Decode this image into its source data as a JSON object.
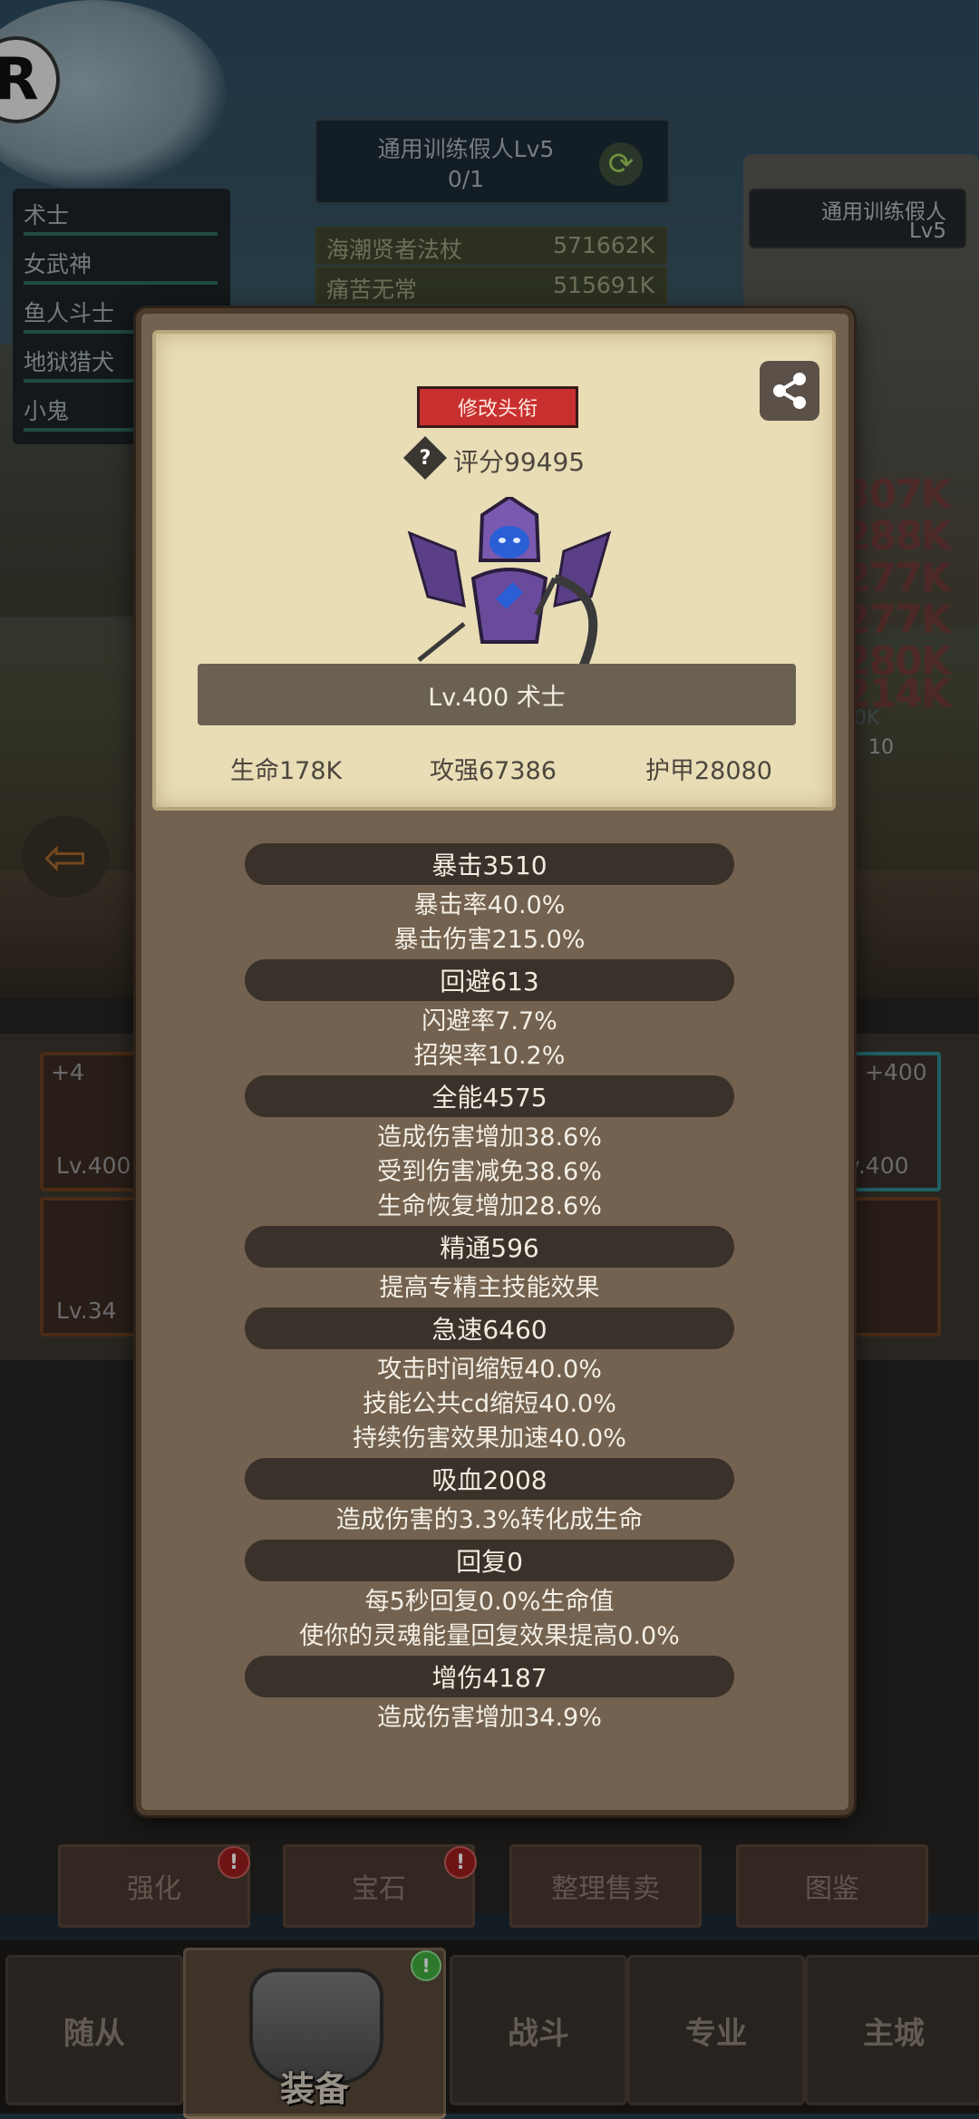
{
  "background": {
    "logo_letter": "R",
    "quest": {
      "title": "通用训练假人Lv5",
      "progress": "0/1",
      "refresh_icon": "refresh-icon"
    },
    "boss_label": {
      "name": "通用训练假人",
      "level": "Lv5"
    },
    "ranking": [
      {
        "name": "海潮贤者法杖",
        "value": "571662K"
      },
      {
        "name": "痛苦无常",
        "value": "515691K"
      }
    ],
    "team": [
      "术士",
      "女武神",
      "鱼人斗士",
      "地狱猎犬",
      "小鬼"
    ],
    "damage_numbers": [
      "307K",
      "288K",
      "277K",
      "277K",
      "280K",
      "214K"
    ],
    "side_values": [
      "90K",
      "10"
    ],
    "equipment_slots": [
      {
        "plus": "+4",
        "level": "Lv.400"
      },
      {
        "plus": "",
        "level": "Lv.34"
      },
      {
        "plus": "+400",
        "level": "v.400"
      },
      {
        "plus": "",
        "level": ""
      }
    ],
    "action_buttons": [
      "强化",
      "宝石",
      "整理售卖",
      "图鉴"
    ],
    "nav_tabs": [
      "随从",
      "装备",
      "战斗",
      "专业",
      "主城"
    ],
    "badge_mark": "!"
  },
  "popup": {
    "title_button": "修改头衔",
    "help_mark": "?",
    "score": "评分99495",
    "name_line": "Lv.400 术士",
    "main_stats": [
      "生命178K",
      "攻强67386",
      "护甲28080"
    ],
    "groups": [
      {
        "header": "暴击3510",
        "lines": [
          "暴击率40.0%",
          "暴击伤害215.0%"
        ]
      },
      {
        "header": "回避613",
        "lines": [
          "闪避率7.7%",
          "招架率10.2%"
        ]
      },
      {
        "header": "全能4575",
        "lines": [
          "造成伤害增加38.6%",
          "受到伤害减免38.6%",
          "生命恢复增加28.6%"
        ]
      },
      {
        "header": "精通596",
        "lines": [
          "提高专精主技能效果"
        ]
      },
      {
        "header": "急速6460",
        "lines": [
          "攻击时间缩短40.0%",
          "技能公共cd缩短40.0%",
          "持续伤害效果加速40.0%"
        ]
      },
      {
        "header": "吸血2008",
        "lines": [
          "造成伤害的3.3%转化成生命"
        ]
      },
      {
        "header": "回复0",
        "lines": [
          "每5秒回复0.0%生命值",
          "使你的灵魂能量回复效果提高0.0%"
        ]
      },
      {
        "header": "增伤4187",
        "lines": [
          "造成伤害增加34.9%"
        ]
      }
    ]
  }
}
